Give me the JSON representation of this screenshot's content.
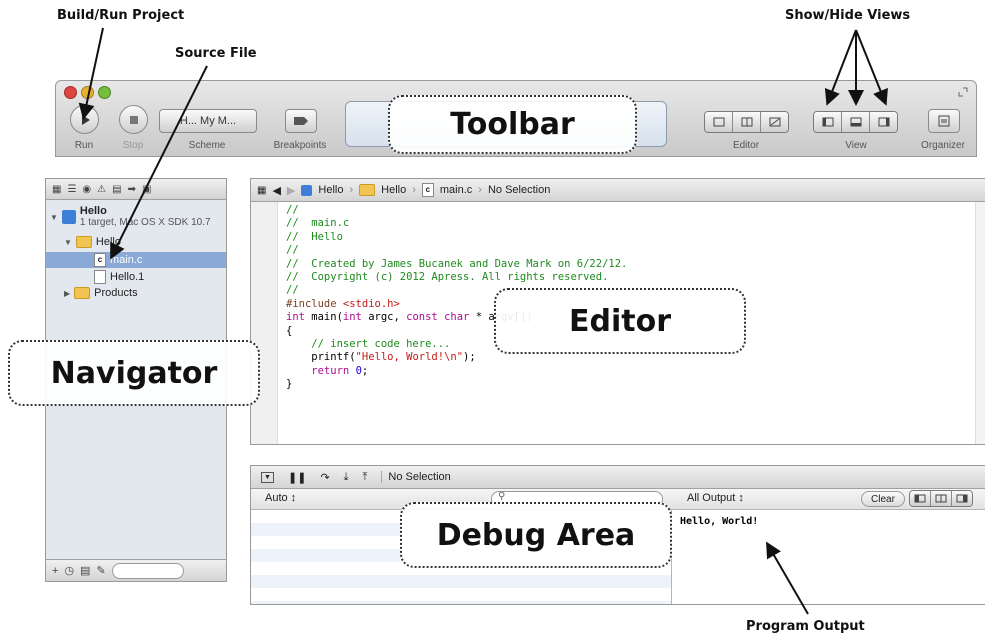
{
  "annotations": {
    "build_run": "Build/Run Project",
    "source_file": "Source File",
    "show_hide": "Show/Hide Views",
    "program_output": "Program Output"
  },
  "callouts": {
    "toolbar": "Toolbar",
    "editor": "Editor",
    "navigator": "Navigator",
    "debug": "Debug Area"
  },
  "toolbar": {
    "run_label": "Run",
    "stop_label": "Stop",
    "scheme_button": "H... My M...",
    "scheme_label": "Scheme",
    "breakpoints_label": "Breakpoints",
    "editor_label": "Editor",
    "view_label": "View",
    "organizer_label": "Organizer"
  },
  "navigator": {
    "project_name": "Hello",
    "project_subtitle": "1 target, Mac OS X SDK 10.7",
    "group_hello": "Hello",
    "file_main": "main.c",
    "file_hello1": "Hello.1",
    "group_products": "Products"
  },
  "editor": {
    "jump_project": "Hello",
    "jump_group": "Hello",
    "jump_file": "main.c",
    "jump_selection": "No Selection",
    "code_lines": [
      "//",
      "//  main.c",
      "//  Hello",
      "//",
      "//  Created by James Bucanek and Dave Mark on 6/22/12.",
      "//  Copyright (c) 2012 Apress. All rights reserved.",
      "//",
      "",
      "#include <stdio.h>",
      "",
      "int main(int argc, const char * argv[])",
      "{",
      "",
      "    // insert code here...",
      "    printf(\"Hello, World!\\n\");",
      "    return 0;",
      "}"
    ]
  },
  "debug": {
    "selection": "No Selection",
    "auto_label": "Auto ↕",
    "all_output": "All Output ↕",
    "clear_button": "Clear",
    "output": "Hello, World!"
  }
}
